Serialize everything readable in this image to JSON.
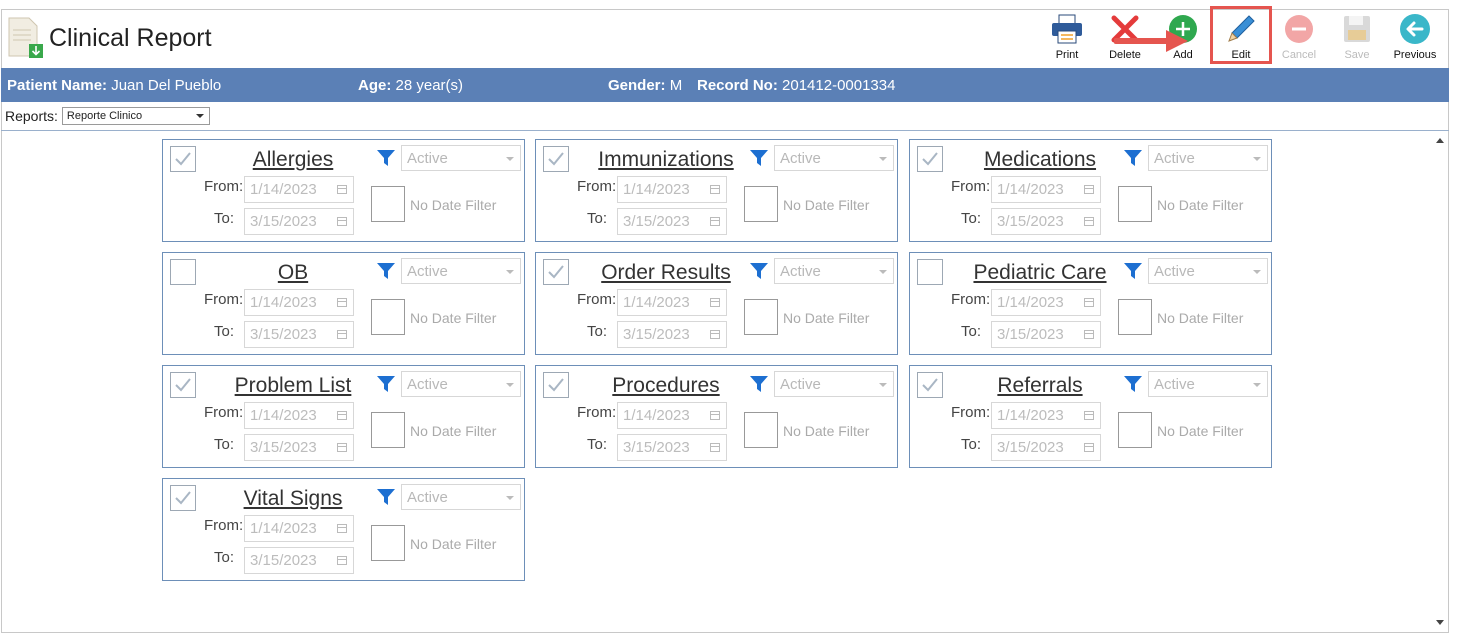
{
  "header": {
    "title": "Clinical Report"
  },
  "toolbar": [
    {
      "label": "Print",
      "icon": "printer-icon",
      "enabled": true
    },
    {
      "label": "Delete",
      "icon": "delete-x-icon",
      "enabled": true
    },
    {
      "label": "Add",
      "icon": "plus-circle-icon",
      "enabled": true
    },
    {
      "label": "Edit",
      "icon": "pencil-icon",
      "enabled": true,
      "highlighted": true
    },
    {
      "label": "Cancel",
      "icon": "minus-circle-icon",
      "enabled": false
    },
    {
      "label": "Save",
      "icon": "floppy-disk-icon",
      "enabled": false
    },
    {
      "label": "Previous",
      "icon": "arrow-left-circle-icon",
      "enabled": true
    }
  ],
  "patient": {
    "name_label": "Patient Name:",
    "name": "Juan Del Pueblo",
    "age_label": "Age:",
    "age": "28 year(s)",
    "gender_label": "Gender:",
    "gender": "M",
    "record_label": "Record No:",
    "record": "201412-0001334"
  },
  "reports": {
    "label": "Reports:",
    "selected": "Reporte Clinico"
  },
  "labels": {
    "from": "From:",
    "to": "To:",
    "no_date_filter": "No Date Filter"
  },
  "sections": [
    {
      "title": "Allergies",
      "checked": true,
      "status": "Active",
      "from": "1/14/2023",
      "to": "3/15/2023"
    },
    {
      "title": "Immunizations",
      "checked": true,
      "status": "Active",
      "from": "1/14/2023",
      "to": "3/15/2023"
    },
    {
      "title": "Medications",
      "checked": true,
      "status": "Active",
      "from": "1/14/2023",
      "to": "3/15/2023"
    },
    {
      "title": "OB",
      "checked": false,
      "status": "Active",
      "from": "1/14/2023",
      "to": "3/15/2023"
    },
    {
      "title": "Order Results",
      "checked": true,
      "status": "Active",
      "from": "1/14/2023",
      "to": "3/15/2023"
    },
    {
      "title": "Pediatric Care",
      "checked": false,
      "status": "Active",
      "from": "1/14/2023",
      "to": "3/15/2023"
    },
    {
      "title": "Problem List",
      "checked": true,
      "status": "Active",
      "from": "1/14/2023",
      "to": "3/15/2023"
    },
    {
      "title": "Procedures",
      "checked": true,
      "status": "Active",
      "from": "1/14/2023",
      "to": "3/15/2023"
    },
    {
      "title": "Referrals",
      "checked": true,
      "status": "Active",
      "from": "1/14/2023",
      "to": "3/15/2023"
    },
    {
      "title": "Vital Signs",
      "checked": true,
      "status": "Active",
      "from": "1/14/2023",
      "to": "3/15/2023"
    }
  ],
  "colors": {
    "bar": "#5b80b6",
    "card_border": "#6d8fb8",
    "filter": "#1d6fd1",
    "highlight": "#e5554f"
  }
}
